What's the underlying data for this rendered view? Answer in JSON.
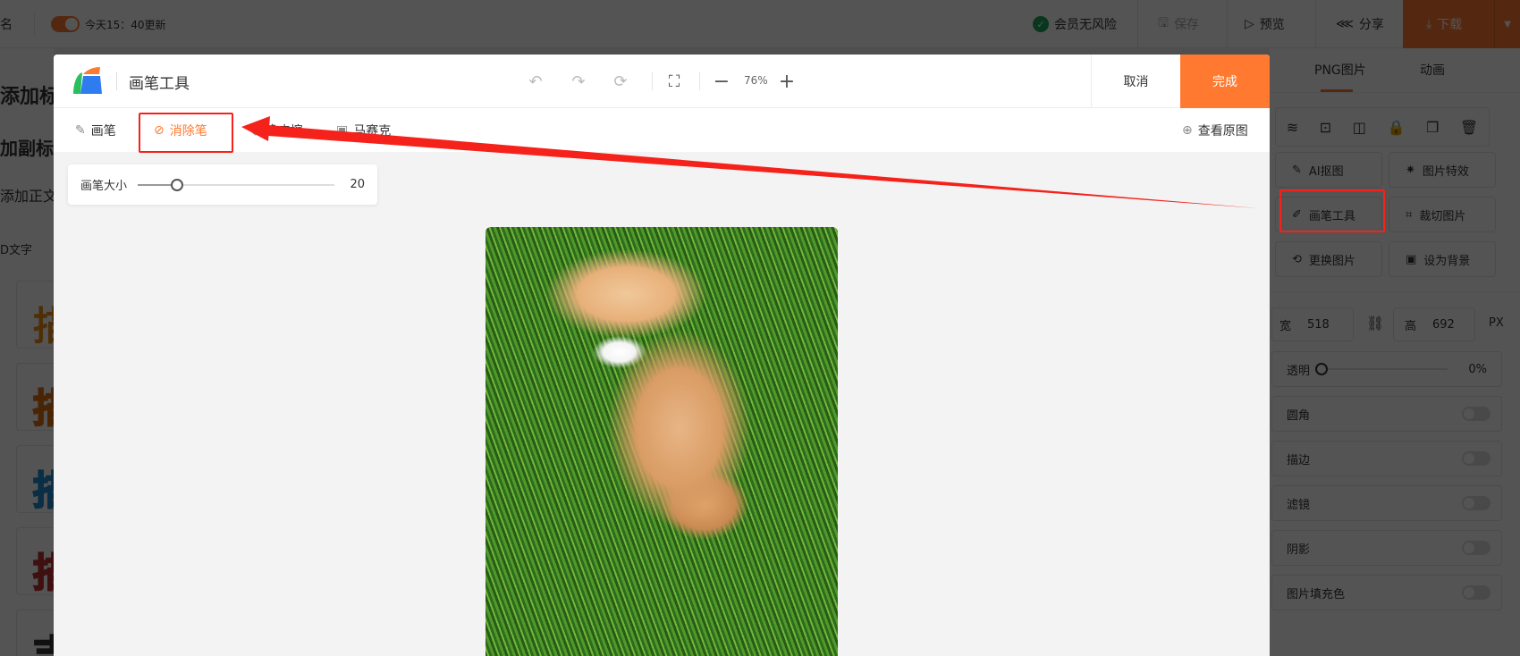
{
  "topbar": {
    "name_partial": "名",
    "autosave_label": "今天15：40更新",
    "member": "会员无风险",
    "save": "保存",
    "preview": "预览",
    "share": "分享",
    "download": "下载"
  },
  "left": {
    "title": "添加标",
    "subtitle": "加副标",
    "body": "添加正文",
    "section": "D文字",
    "tiles": [
      "描",
      "描",
      "描",
      "描",
      "吉"
    ]
  },
  "right": {
    "tabs": [
      "PNG图片",
      "动画"
    ],
    "buttons": [
      "AI抠图",
      "图片特效",
      "画笔工具",
      "裁切图片",
      "更换图片",
      "设为背景"
    ],
    "width_label": "宽",
    "width": "518",
    "height_label": "高",
    "height": "692",
    "unit": "PX",
    "opacity_label": "透明",
    "opacity": "0%",
    "opacity_value": 0,
    "switches": [
      "圆角",
      "描边",
      "滤镜",
      "阴影",
      "图片填充色"
    ]
  },
  "modal": {
    "title": "画笔工具",
    "zoom": "76%",
    "cancel": "取消",
    "done": "完成",
    "tools": [
      "画笔",
      "消除笔",
      "橡皮擦",
      "马赛克"
    ],
    "view_original": "查看原图",
    "brush_size_label": "画笔大小",
    "brush_size": "20",
    "brush_size_min": 0,
    "brush_size_max": 100
  },
  "colors": {
    "accent": "#ff7a30",
    "annotation": "#f5221b"
  }
}
